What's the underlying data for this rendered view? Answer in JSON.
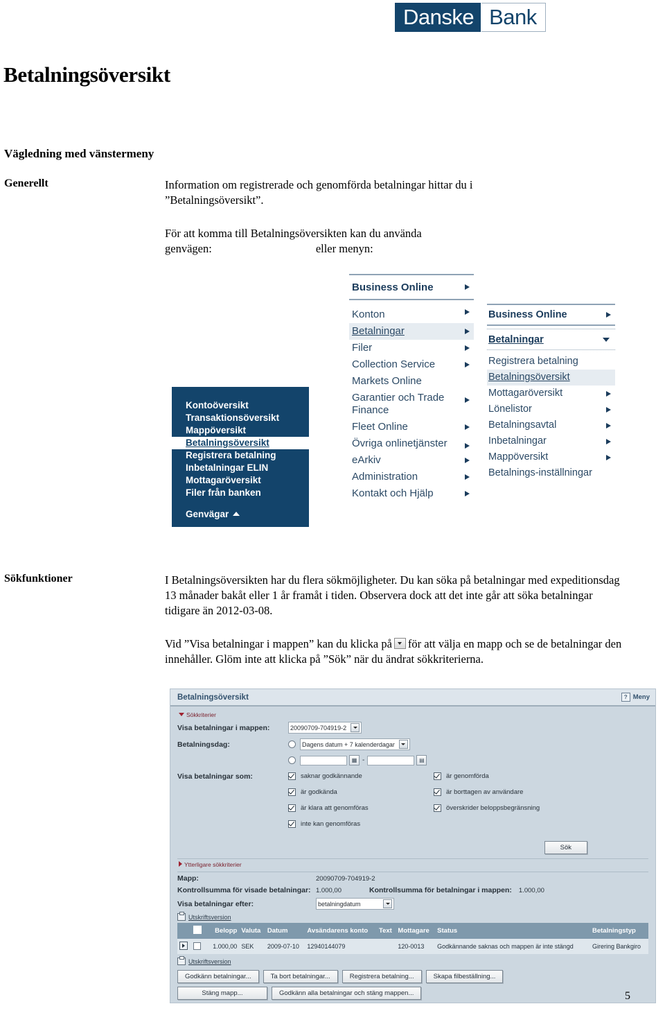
{
  "logo": {
    "left": "Danske",
    "right": "Bank"
  },
  "document": {
    "title": "Betalningsöversikt",
    "section_heading": "Vägledning med vänstermeny",
    "page_number": "5"
  },
  "sections": {
    "generellt": {
      "label": "Generellt",
      "paragraph1_line1": "Information om registrerade och genomförda betalningar hittar du i",
      "paragraph1_line2": "”Betalningsöversikt”.",
      "paragraph2_line1": "För att komma till Betalningsöversikten kan du använda",
      "paragraph2_line2a": "genvägen:",
      "paragraph2_line2b": "eller menyn:"
    },
    "sokfunktioner": {
      "label": "Sökfunktioner",
      "paragraph1": "I Betalningsöversikten har du flera sökmöjligheter. Du kan söka på betalningar med expeditionsdag 13 månader  bakåt eller 1 år framåt i tiden. Observera dock att det inte går att söka betalningar tidigare än 2012-03-08.",
      "paragraph2_part1": "Vid ”Visa betalningar i mappen” kan du klicka på",
      "paragraph2_part2": "för att välja en mapp och se de betalningar den innehåller. Glöm inte att klicka på ”Sök” när du ändrat sökkriterierna."
    }
  },
  "shortcut_menu": {
    "items": [
      "Kontoöversikt",
      "Transaktionsöversikt",
      "Mappöversikt",
      "Betalningsöversikt",
      "Registrera betalning",
      "Inbetalningar ELIN",
      "Mottagaröversikt",
      "Filer från banken"
    ],
    "active_index": 3,
    "footer": "Genvägar"
  },
  "main_menu": {
    "header": "Business Online",
    "items": [
      {
        "label": "Konton",
        "arrow": true
      },
      {
        "label": "Betalningar",
        "arrow": true,
        "active": true
      },
      {
        "label": "Filer",
        "arrow": true
      },
      {
        "label": "Collection Service",
        "arrow": true
      },
      {
        "label": "Markets Online",
        "arrow": false
      },
      {
        "label": "Garantier och Trade Finance",
        "arrow": true
      },
      {
        "label": "Fleet Online",
        "arrow": true
      },
      {
        "label": "Övriga onlinetjänster",
        "arrow": true
      },
      {
        "label": "eArkiv",
        "arrow": true
      },
      {
        "label": "Administration",
        "arrow": true
      },
      {
        "label": "Kontakt och Hjälp",
        "arrow": true
      }
    ]
  },
  "sub_menu": {
    "header": "Business Online",
    "section": "Betalningar",
    "items": [
      {
        "label": "Registrera betalning",
        "arrow": false
      },
      {
        "label": "Betalningsöversikt",
        "arrow": false,
        "active": true
      },
      {
        "label": "Mottagaröversikt",
        "arrow": true
      },
      {
        "label": "Lönelistor",
        "arrow": true
      },
      {
        "label": "Betalningsavtal",
        "arrow": true
      },
      {
        "label": "Inbetalningar",
        "arrow": true
      },
      {
        "label": "Mappöversikt",
        "arrow": true
      },
      {
        "label": "Betalnings-inställningar",
        "arrow": false
      }
    ]
  },
  "app": {
    "title": "Betalningsöversikt",
    "meny_label": "Meny",
    "meny_icon": "?",
    "search_criteria_toggle": "Sökkriterier",
    "more_criteria_toggle": "Ytterligare sökkriterier",
    "fields": {
      "folder_label": "Visa betalningar i mappen:",
      "folder_value": "20090709-704919-2",
      "payday_label": "Betalningsdag:",
      "payday_value": "Dagens datum + 7 kalenderdagar",
      "date_from": "",
      "date_to": "",
      "show_as_label": "Visa betalningar som:"
    },
    "checkboxes_left": [
      "saknar godkännande",
      "är godkända",
      "är klara att genomföras",
      "inte kan genomföras"
    ],
    "checkboxes_right": [
      "är genomförda",
      "är borttagen av användare",
      "överskrider beloppsbegränsning"
    ],
    "search_button": "Sök",
    "summary": {
      "folder_label": "Mapp:",
      "folder_value": "20090709-704919-2",
      "checksum_shown_label": "Kontrollsumma för visade betalningar:",
      "checksum_shown_value": "1.000,00",
      "checksum_folder_label": "Kontrollsumma för betalningar i mappen:",
      "checksum_folder_value": "1.000,00",
      "sort_label": "Visa betalningar efter:",
      "sort_value": "betalningdatum"
    },
    "print_link": "Utskriftsversion",
    "table": {
      "columns": [
        "",
        "",
        "Belopp",
        "Valuta",
        "Datum",
        "Avsändarens konto",
        "Text",
        "Mottagare",
        "Status",
        "Betalningstyp"
      ],
      "rows": [
        {
          "amount": "1.000,00",
          "currency": "SEK",
          "date": "2009-07-10",
          "sender_account": "12940144079",
          "text": "",
          "recipient": "120-0013",
          "status": "Godkännande saknas och mappen är inte stängd",
          "payment_type": "Girering Bankgiro"
        }
      ]
    },
    "buttons_row1": [
      "Godkänn betalningar...",
      "Ta bort betalningar...",
      "Registrera betalning...",
      "Skapa filbeställning..."
    ],
    "buttons_row2": [
      "Stäng mapp...",
      "Godkänn alla betalningar och stäng mappen..."
    ]
  }
}
